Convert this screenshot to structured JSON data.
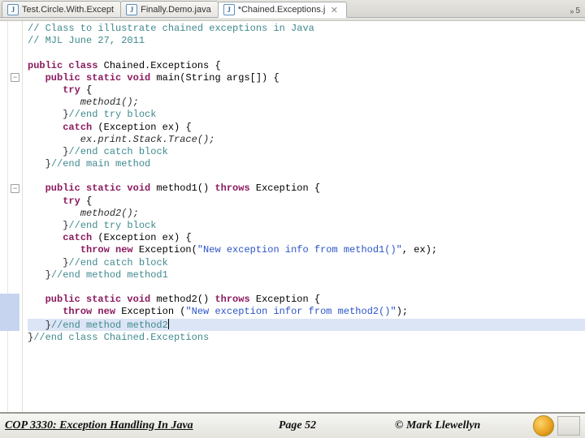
{
  "tabs": [
    {
      "label": "Test.Circle.With.Except",
      "active": false,
      "dirty": false
    },
    {
      "label": "Finally.Demo.java",
      "active": false,
      "dirty": false
    },
    {
      "label": "*Chained.Exceptions.j",
      "active": true,
      "dirty": true
    }
  ],
  "overflow_label": "5",
  "code_lines": [
    {
      "i": 0,
      "type": "cmt",
      "indent": 0,
      "text": "// Class to illustrate chained exceptions in Java"
    },
    {
      "i": 1,
      "type": "cmt",
      "indent": 0,
      "text": "// MJL June 27, 2011"
    },
    {
      "i": 2,
      "type": "blank",
      "indent": 0,
      "text": ""
    },
    {
      "i": 3,
      "type": "code",
      "indent": 0,
      "tokens": [
        [
          "kw",
          "public class"
        ],
        [
          "typ",
          " Chained.Exceptions {"
        ]
      ]
    },
    {
      "i": 4,
      "type": "code",
      "indent": 1,
      "fold": true,
      "tokens": [
        [
          "kw",
          "public static void"
        ],
        [
          "typ",
          " main(String args[]) {"
        ]
      ]
    },
    {
      "i": 5,
      "type": "code",
      "indent": 2,
      "tokens": [
        [
          "kw",
          "try"
        ],
        [
          "typ",
          " {"
        ]
      ]
    },
    {
      "i": 6,
      "type": "ital",
      "indent": 3,
      "text": "method1();"
    },
    {
      "i": 7,
      "type": "mixed",
      "indent": 2,
      "close": "}",
      "cmt": "//end try block"
    },
    {
      "i": 8,
      "type": "code",
      "indent": 2,
      "tokens": [
        [
          "kw",
          "catch"
        ],
        [
          "typ",
          " (Exception ex) {"
        ]
      ]
    },
    {
      "i": 9,
      "type": "ital",
      "indent": 3,
      "text": "ex.print.Stack.Trace();"
    },
    {
      "i": 10,
      "type": "mixed",
      "indent": 2,
      "close": "}",
      "cmt": "//end catch block"
    },
    {
      "i": 11,
      "type": "mixed",
      "indent": 1,
      "close": "}",
      "cmt": "//end main method"
    },
    {
      "i": 12,
      "type": "blank",
      "indent": 0,
      "text": ""
    },
    {
      "i": 13,
      "type": "code",
      "indent": 1,
      "fold": true,
      "tokens": [
        [
          "kw",
          "public static void"
        ],
        [
          "typ",
          " method1() "
        ],
        [
          "kw",
          "throws"
        ],
        [
          "typ",
          " Exception {"
        ]
      ]
    },
    {
      "i": 14,
      "type": "code",
      "indent": 2,
      "tokens": [
        [
          "kw",
          "try"
        ],
        [
          "typ",
          " {"
        ]
      ]
    },
    {
      "i": 15,
      "type": "ital",
      "indent": 3,
      "text": "method2();"
    },
    {
      "i": 16,
      "type": "mixed",
      "indent": 2,
      "close": "}",
      "cmt": "//end try block"
    },
    {
      "i": 17,
      "type": "code",
      "indent": 2,
      "tokens": [
        [
          "kw",
          "catch"
        ],
        [
          "typ",
          " (Exception ex) {"
        ]
      ]
    },
    {
      "i": 18,
      "type": "code",
      "indent": 3,
      "tokens": [
        [
          "kw",
          "throw new"
        ],
        [
          "typ",
          " Exception("
        ],
        [
          "str",
          "\"New exception info from method1()\""
        ],
        [
          "typ",
          ", ex);"
        ]
      ]
    },
    {
      "i": 19,
      "type": "mixed",
      "indent": 2,
      "close": "}",
      "cmt": "//end catch block"
    },
    {
      "i": 20,
      "type": "mixed",
      "indent": 1,
      "close": "}",
      "cmt": "//end method method1"
    },
    {
      "i": 21,
      "type": "blank",
      "indent": 0,
      "text": ""
    },
    {
      "i": 22,
      "type": "code",
      "indent": 1,
      "fold": true,
      "tokens": [
        [
          "kw",
          "public static void"
        ],
        [
          "typ",
          " method2() "
        ],
        [
          "kw",
          "throws"
        ],
        [
          "typ",
          " Exception {"
        ]
      ]
    },
    {
      "i": 23,
      "type": "code",
      "indent": 2,
      "tokens": [
        [
          "kw",
          "throw new"
        ],
        [
          "typ",
          " Exception ("
        ],
        [
          "str",
          "\"New exception infor from method2()\""
        ],
        [
          "typ",
          ");"
        ]
      ]
    },
    {
      "i": 24,
      "type": "mixed",
      "indent": 1,
      "close": "}",
      "cmt": "//end method method2",
      "caret": true,
      "highlight": true
    },
    {
      "i": 25,
      "type": "mixed",
      "indent": 0,
      "close": "}",
      "cmt": "//end class Chained.Exceptions"
    }
  ],
  "footer": {
    "course": "COP 3330:  Exception Handling In Java",
    "page": "Page 52",
    "copy": "© Mark Llewellyn"
  },
  "icons": {
    "java_letter": "J",
    "close_glyph": "✕",
    "chevrons": "»",
    "fold_minus": "−"
  }
}
